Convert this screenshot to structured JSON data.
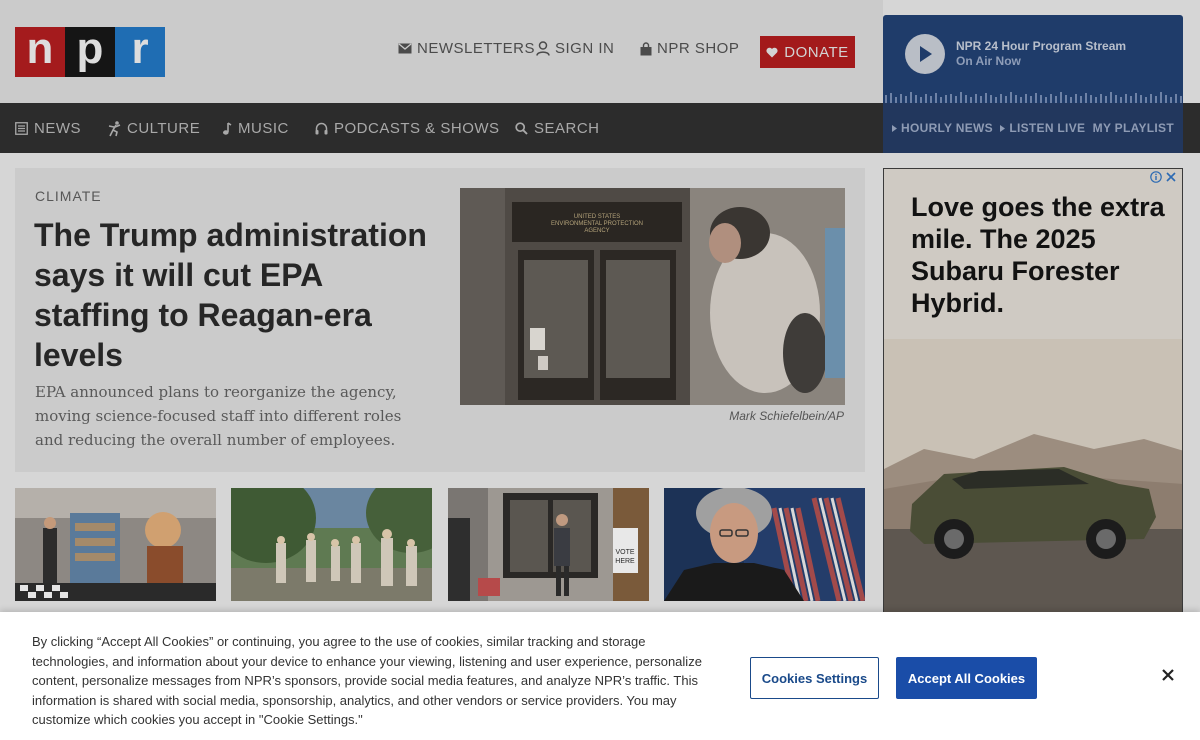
{
  "header": {
    "logo": [
      "n",
      "p",
      "r"
    ],
    "newsletters": "NEWSLETTERS",
    "sign_in": "SIGN IN",
    "shop": "NPR SHOP",
    "donate": "DONATE"
  },
  "player": {
    "title": "NPR 24 Hour Program Stream",
    "subtitle": "On Air Now"
  },
  "nav": {
    "items": [
      "NEWS",
      "CULTURE",
      "MUSIC",
      "PODCASTS & SHOWS",
      "SEARCH"
    ]
  },
  "subnav": {
    "items": [
      "HOURLY NEWS",
      "LISTEN LIVE",
      "MY PLAYLIST"
    ]
  },
  "story": {
    "kicker": "CLIMATE",
    "headline": "The Trump administration says it will cut EPA staffing to Reagan-era levels",
    "teaser": "EPA announced plans to reorganize the agency, moving science-focused staff into different roles and reducing the overall number of employees.",
    "credit": "Mark Schiefelbein/AP",
    "image_sign": [
      "UNITED STATES",
      "ENVIRONMENTAL PROTECTION",
      "AGENCY"
    ]
  },
  "thumbnails": {
    "vote_sign": [
      "VOTE",
      "HERE"
    ]
  },
  "ad": {
    "text": "Love goes the extra mile. The 2025 Subaru Forester Hybrid."
  },
  "cookie": {
    "text": "By clicking “Accept All Cookies” or continuing, you agree to the use of cookies, similar tracking and storage technologies, and information about your device to enhance your viewing, listening and user experience, personalize content, personalize messages from NPR’s sponsors, provide social media features, and analyze NPR’s traffic. This information is shared with social media, sponsorship, analytics, and other vendors or service providers. You may customize which cookies you accept in \"Cookie Settings.\"",
    "settings_label": "Cookies Settings",
    "accept_label": "Accept All Cookies"
  },
  "colors": {
    "npr_red": "#a41b1d",
    "npr_black": "#151515",
    "npr_blue": "#1f6db3",
    "player_blue": "#1f3c6a",
    "accept_blue": "#1a4da8"
  }
}
